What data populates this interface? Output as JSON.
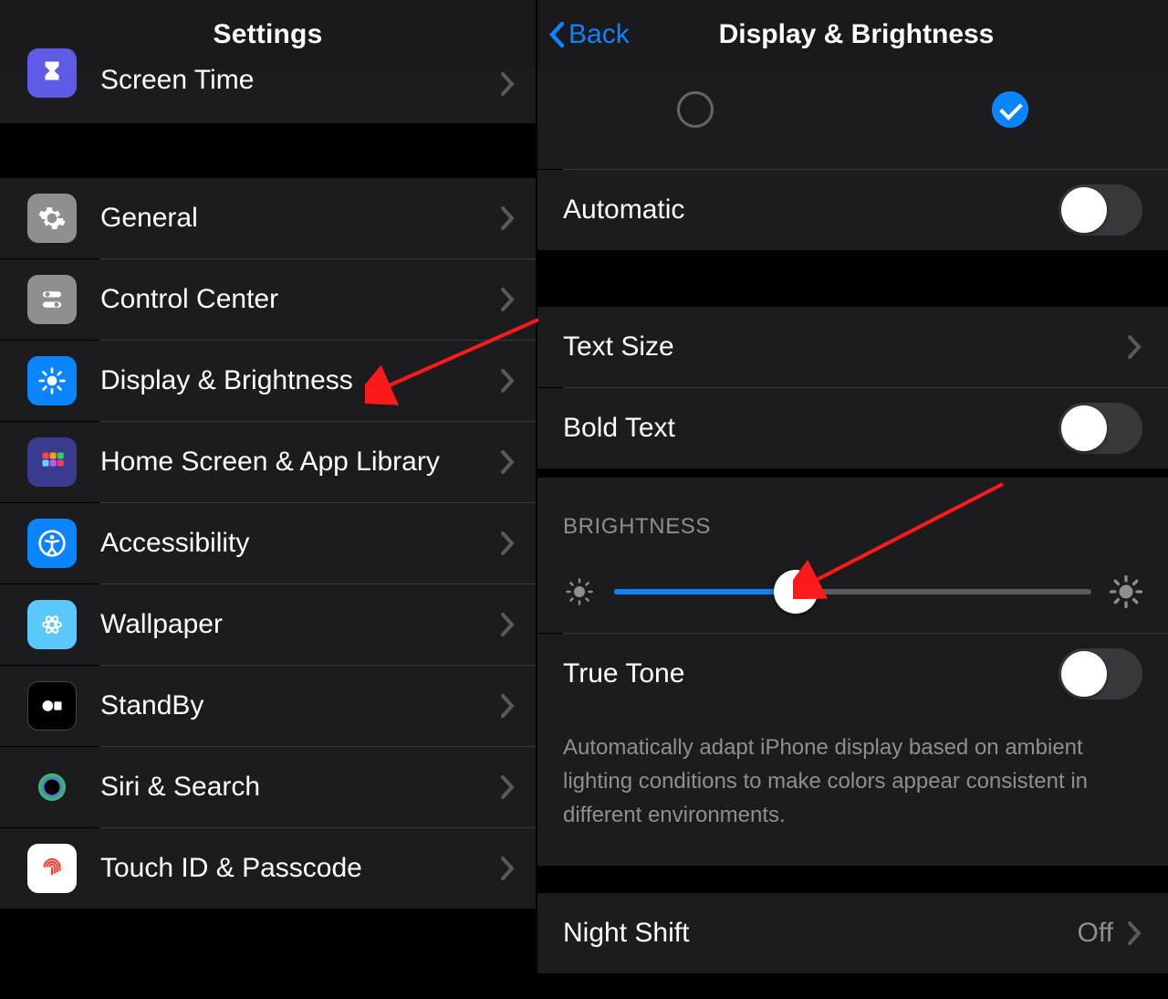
{
  "left": {
    "title": "Settings",
    "items": [
      {
        "label": "Screen Time",
        "icon": "hourglass-icon",
        "bg": "#5e5ce6"
      },
      {
        "label": "General",
        "icon": "gear-icon",
        "bg": "#8e8e93"
      },
      {
        "label": "Control Center",
        "icon": "switch-icon",
        "bg": "#8e8e93"
      },
      {
        "label": "Display & Brightness",
        "icon": "brightness-icon",
        "bg": "#0a84ff"
      },
      {
        "label": "Home Screen & App Library",
        "icon": "apps-icon",
        "bg": "#4e4e9e"
      },
      {
        "label": "Accessibility",
        "icon": "accessibility-icon",
        "bg": "#0a84ff"
      },
      {
        "label": "Wallpaper",
        "icon": "wallpaper-icon",
        "bg": "#5ac8fa"
      },
      {
        "label": "StandBy",
        "icon": "standby-icon",
        "bg": "#000"
      },
      {
        "label": "Siri & Search",
        "icon": "siri-icon",
        "bg": "#1c1c1e"
      },
      {
        "label": "Touch ID & Passcode",
        "icon": "fingerprint-icon",
        "bg": "#fff"
      }
    ]
  },
  "right": {
    "back": "Back",
    "title": "Display & Brightness",
    "appearance": {
      "lightChecked": false,
      "darkChecked": true
    },
    "automatic": {
      "label": "Automatic",
      "on": false
    },
    "textSize": {
      "label": "Text Size"
    },
    "boldText": {
      "label": "Bold Text",
      "on": false
    },
    "brightnessHeader": "BRIGHTNESS",
    "brightnessPercent": 38,
    "trueTone": {
      "label": "True Tone",
      "on": false
    },
    "trueToneFooter": "Automatically adapt iPhone display based on ambient lighting conditions to make colors appear consistent in different environments.",
    "nightShift": {
      "label": "Night Shift",
      "value": "Off"
    }
  }
}
